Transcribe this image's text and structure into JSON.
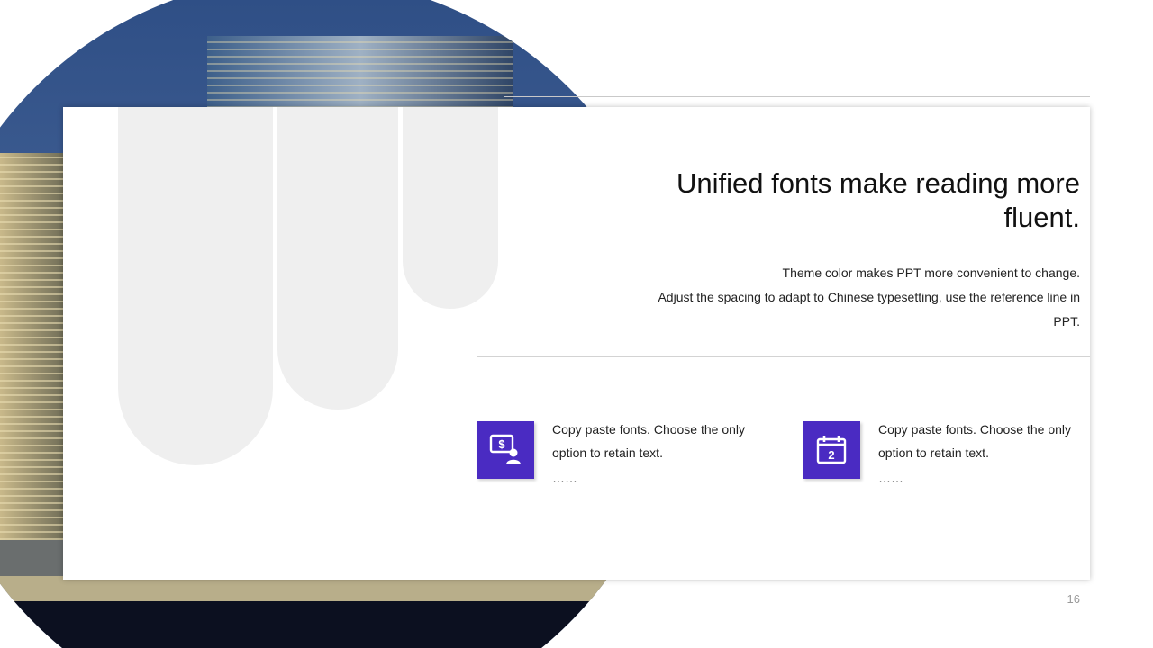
{
  "slide": {
    "title": "Unified fonts make reading more fluent.",
    "subtext_line1": "Theme color makes PPT more convenient to change.",
    "subtext_line2": "Adjust the spacing to adapt to Chinese typesetting, use the reference line in PPT.",
    "page_number": "16"
  },
  "features": [
    {
      "icon": "monitor-dollar-person-icon",
      "text": "Copy paste fonts. Choose the only option to retain text.",
      "ellipsis": "……"
    },
    {
      "icon": "calendar-2-icon",
      "text": "Copy paste fonts. Choose the only option to retain text.",
      "ellipsis": "……"
    }
  ],
  "colors": {
    "accent": "#4a2bc2",
    "sky": "#3b5b8e",
    "background": "#ffffff"
  }
}
